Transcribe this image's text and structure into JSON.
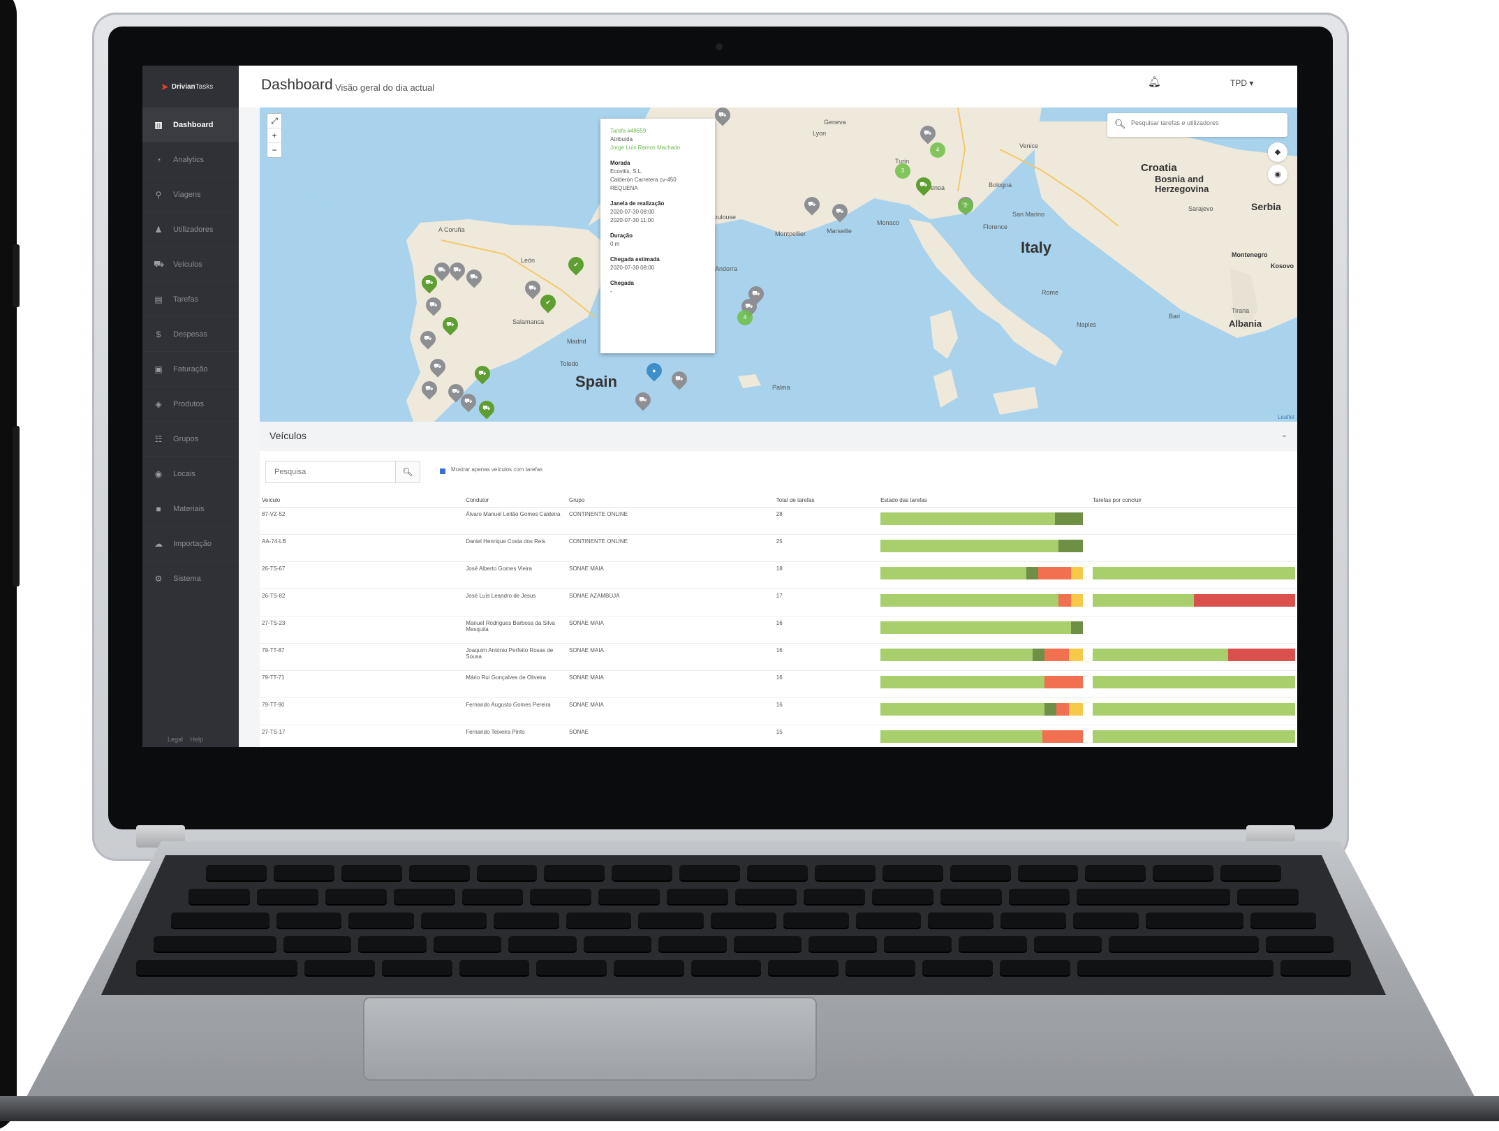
{
  "app": {
    "brand_a": "Drivian",
    "brand_b": "Tasks",
    "title": "Dashboard",
    "subtitle": "Visão geral do dia actual",
    "user": "TPD",
    "footer_links": [
      "Legal",
      "Help"
    ]
  },
  "sidebar": {
    "items": [
      {
        "label": "Dashboard",
        "icon": "bar-chart-icon",
        "glyph": "▥",
        "active": true
      },
      {
        "label": "Analytics",
        "icon": "pie-chart-icon",
        "glyph": "◔"
      },
      {
        "label": "Viagens",
        "icon": "map-pin-icon",
        "glyph": "⚲"
      },
      {
        "label": "Utilizadores",
        "icon": "user-icon",
        "glyph": "♟"
      },
      {
        "label": "Veículos",
        "icon": "car-icon",
        "glyph": "⛟"
      },
      {
        "label": "Tarefas",
        "icon": "list-icon",
        "glyph": "▤"
      },
      {
        "label": "Despesas",
        "icon": "dollar-icon",
        "glyph": "$"
      },
      {
        "label": "Faturação",
        "icon": "invoice-icon",
        "glyph": "▣"
      },
      {
        "label": "Produtos",
        "icon": "box-icon",
        "glyph": "◈"
      },
      {
        "label": "Grupos",
        "icon": "group-icon",
        "glyph": "☷"
      },
      {
        "label": "Locais",
        "icon": "location-icon",
        "glyph": "◉"
      },
      {
        "label": "Materiais",
        "icon": "material-icon",
        "glyph": "■"
      },
      {
        "label": "Importação",
        "icon": "cloud-upload-icon",
        "glyph": "☁"
      },
      {
        "label": "Sistema",
        "icon": "gear-icon",
        "glyph": "⚙"
      }
    ]
  },
  "map": {
    "search_placeholder": "Pesquisar tarefas e utilizadores",
    "attribution": "Leaflet",
    "labels": [
      "Spain",
      "Italy",
      "Croatia",
      "Bosnia and Herzegovina",
      "Serbia",
      "Montenegro",
      "Kosovo",
      "Albania",
      "Madrid",
      "Geneva",
      "Lyon",
      "Venice",
      "Bologna",
      "Florence",
      "San Marino",
      "Rome",
      "Naples",
      "Bari",
      "Tirana",
      "Marseille",
      "Montpellier",
      "Monaco",
      "Toulouse",
      "Andorra",
      "Palma",
      "Salamanca",
      "Toledo",
      "A Coruña",
      "León",
      "Sarajevo",
      "Genoa",
      "Turin"
    ],
    "popup": {
      "task": "Tarefa #48659",
      "status": "Atribuída",
      "driver": "Jorge Luís Ramos Machado",
      "morada_label": "Morada",
      "morada": [
        "Ecovitis, S.L.",
        "Calderón Carretera cv-450",
        "REQUENA"
      ],
      "janela_label": "Janela de realização",
      "janela": [
        "2020-07-30 08:00",
        "2020-07-30 11:00"
      ],
      "duracao_label": "Duração",
      "duracao": "0 m",
      "estimada_label": "Chegada estimada",
      "estimada": "2020-07-30 08:00",
      "chegada_label": "Chegada",
      "chegada": "-"
    }
  },
  "vehicles": {
    "title": "Veículos",
    "search_placeholder": "Pesquisa",
    "filter_label": "Mostrar apenas veículos com tarefas",
    "columns": [
      "Veículo",
      "Condutor",
      "Grupo",
      "Total de tarefas",
      "Estado das tarefas",
      "Tarefas por concluir"
    ],
    "colors": {
      "done": "#a8cf6b",
      "dark": "#6f8f45",
      "red": "#f07050",
      "yellow": "#f7c948",
      "late": "#d9504d"
    },
    "rows": [
      {
        "plate": "87-VZ-52",
        "driver": "Álvaro Manuel Leitão Gomes Caldeira",
        "group": "CONTINENTE ONLINE",
        "total": "28",
        "status": [
          0.86,
          0.14,
          0,
          0
        ],
        "pending": null
      },
      {
        "plate": "AA-74-LB",
        "driver": "Daniel Henrique Costa dos Reis",
        "group": "CONTINENTE ONLINE",
        "total": "25",
        "status": [
          0.88,
          0.12,
          0,
          0
        ],
        "pending": null
      },
      {
        "plate": "26-TS-67",
        "driver": "José Alberto Gomes Vieira",
        "group": "SONAE MAIA",
        "total": "18",
        "status": [
          0.72,
          0.06,
          0.16,
          0.06
        ],
        "pending": [
          1.0,
          0
        ]
      },
      {
        "plate": "26-TS-82",
        "driver": "José Luís Leandro de Jesus",
        "group": "SONAE AZAMBUJA",
        "total": "17",
        "status": [
          0.88,
          0,
          0.06,
          0.06
        ],
        "pending": [
          0.5,
          0.5
        ]
      },
      {
        "plate": "27-TS-23",
        "driver": "Manuel Rodrigues Barbosa da Silva Mesquita",
        "group": "SONAE MAIA",
        "total": "16",
        "status": [
          0.94,
          0.06,
          0,
          0
        ],
        "pending": null
      },
      {
        "plate": "79-TT-87",
        "driver": "Joaquim António Perfeito Rosas de Sousa",
        "group": "SONAE MAIA",
        "total": "16",
        "status": [
          0.75,
          0.06,
          0.12,
          0.07
        ],
        "pending": [
          0.67,
          0.33
        ]
      },
      {
        "plate": "79-TT-71",
        "driver": "Mário Rui Gonçalves de Oliveira",
        "group": "SONAE MAIA",
        "total": "16",
        "status": [
          0.81,
          0,
          0.19,
          0
        ],
        "pending": [
          1.0,
          0
        ]
      },
      {
        "plate": "79-TT-90",
        "driver": "Fernando Augusto Gomes Pereira",
        "group": "SONAE MAIA",
        "total": "16",
        "status": [
          0.81,
          0.06,
          0.06,
          0.07
        ],
        "pending": [
          1.0,
          0
        ]
      },
      {
        "plate": "27-TS-17",
        "driver": "Fernando Teixeira Pinto",
        "group": "SONAE",
        "total": "15",
        "status": [
          0.8,
          0,
          0.2,
          0
        ],
        "pending": [
          1.0,
          0
        ]
      }
    ]
  }
}
